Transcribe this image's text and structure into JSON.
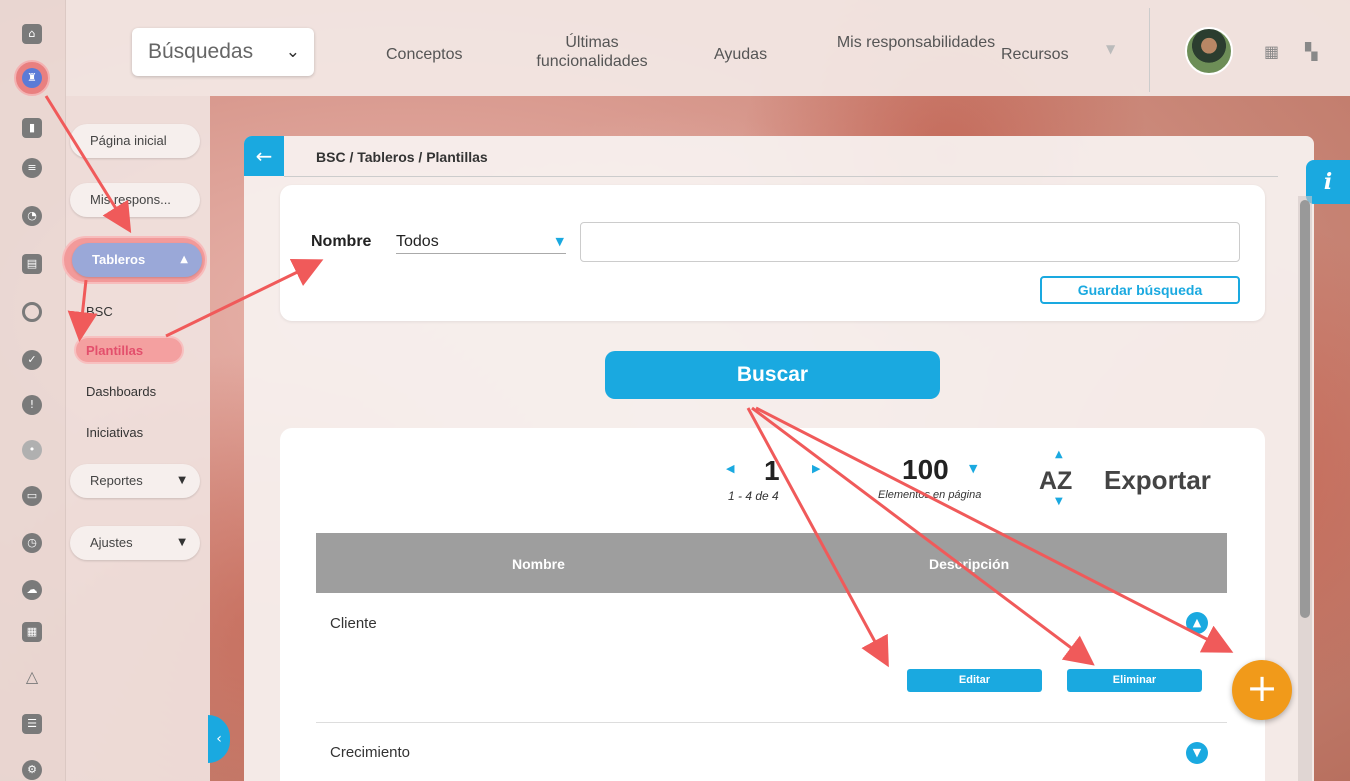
{
  "topbar": {
    "search_select": "Búsquedas",
    "nav": [
      "Conceptos",
      "Últimas funcionalidades",
      "Ayudas",
      "Mis responsabilidades",
      "Recursos"
    ]
  },
  "sidebar": {
    "items": [
      {
        "label": "Página inicial"
      },
      {
        "label": "Mis respons..."
      },
      {
        "label": "Tableros"
      },
      {
        "label": "Reportes"
      },
      {
        "label": "Ajustes"
      }
    ],
    "sub_items": [
      "BSC",
      "Plantillas",
      "Dashboards",
      "Iniciativas"
    ]
  },
  "breadcrumb": "BSC / Tableros / Plantillas",
  "filter": {
    "label": "Nombre",
    "select_value": "Todos",
    "input_value": "",
    "save_label": "Guardar búsqueda"
  },
  "search_button": "Buscar",
  "pagination": {
    "page": "1",
    "range": "1 - 4 de 4",
    "per_page": "100",
    "per_page_label": "Elementos en página",
    "sort_label": "AZ",
    "export_label": "Exportar"
  },
  "table": {
    "headers": [
      "Nombre",
      "Descripción"
    ],
    "rows": [
      {
        "name": "Cliente",
        "edit": "Editar",
        "delete": "Eliminar"
      },
      {
        "name": "Crecimiento"
      }
    ]
  },
  "colors": {
    "accent": "#1aa9e0",
    "fab": "#f19a1a",
    "annotation": "#f05a5a"
  },
  "icons": [
    "home-icon",
    "castle-icon",
    "bar-chart-icon",
    "list-icon",
    "pie-chart-icon",
    "document-icon",
    "circle-icon",
    "check-icon",
    "warning-icon",
    "nodes-icon",
    "monitor-icon",
    "clock-icon",
    "cloud-icon",
    "calendar-icon",
    "triangle-icon",
    "list-box-icon",
    "gear-icon"
  ]
}
